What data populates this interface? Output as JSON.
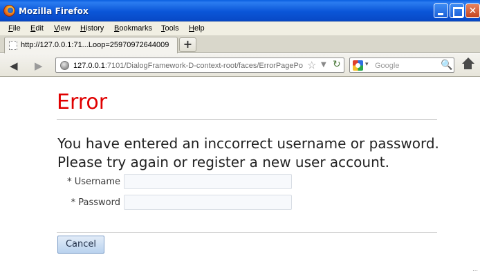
{
  "window": {
    "title": "Mozilla Firefox",
    "minimize_icon": "minimize-icon",
    "maximize_icon": "maximize-icon",
    "close_glyph": "✕"
  },
  "menu": {
    "items": [
      "File",
      "Edit",
      "View",
      "History",
      "Bookmarks",
      "Tools",
      "Help"
    ]
  },
  "tabs": [
    {
      "label": "http://127.0.0.1:71...Loop=25970972644009",
      "icon": "blank-page-icon"
    }
  ],
  "newtab": {
    "label": "+"
  },
  "nav": {
    "back_glyph": "◀",
    "forward_glyph": "▶",
    "url_host": "127.0.0.1",
    "url_rest": ":7101/DialogFramework-D-context-root/faces/ErrorPagePo",
    "star_glyph": "☆",
    "dropdown_glyph": "▼",
    "reload_glyph": "↻",
    "search_placeholder": "Google",
    "search_dropdown_glyph": "▾",
    "magnifier_glyph": "🔍"
  },
  "page": {
    "title": "Error",
    "title_color": "#e00000",
    "message_line1": "You have entered an inccorrect username or password.",
    "message_line2": "Please try again or register a new user account.",
    "username_label": "* Username",
    "password_label": "* Password",
    "username_value": "",
    "password_value": "",
    "cancel_label": "Cancel"
  },
  "status": {
    "resize_grip": "⋯"
  }
}
